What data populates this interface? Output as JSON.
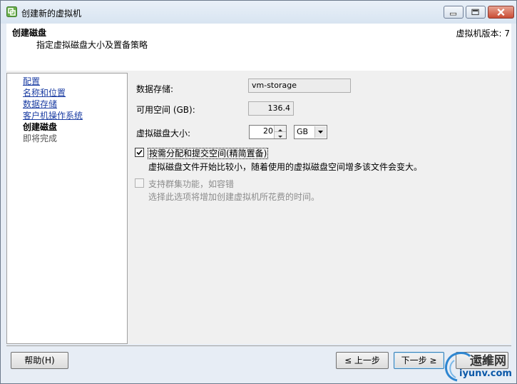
{
  "window": {
    "title": "创建新的虚拟机"
  },
  "header": {
    "title": "创建磁盘",
    "subtitle": "指定虚拟磁盘大小及置备策略",
    "version": "虚拟机版本: 7"
  },
  "nav": {
    "items": [
      {
        "label": "配置",
        "state": "link"
      },
      {
        "label": "名称和位置",
        "state": "link"
      },
      {
        "label": "数据存储",
        "state": "link"
      },
      {
        "label": "客户机操作系统",
        "state": "link"
      },
      {
        "label": "创建磁盘",
        "state": "current"
      },
      {
        "label": "即将完成",
        "state": "pending"
      }
    ]
  },
  "form": {
    "datastore_label": "数据存储:",
    "datastore_value": "vm-storage",
    "free_space_label": "可用空间 (GB):",
    "free_space_value": "136.4",
    "disk_size_label": "虚拟磁盘大小:",
    "disk_size_value": "20",
    "disk_size_unit": "GB",
    "thin_checkbox_label": "按需分配和提交空间(精简置备)",
    "thin_checkbox_checked": true,
    "thin_description": "虚拟磁盘文件开始比较小，随着使用的虚拟磁盘空间增多该文件会变大。",
    "cluster_checkbox_label": "支持群集功能，如容错",
    "cluster_checkbox_checked": false,
    "cluster_description": "选择此选项将增加创建虚拟机所花费的时间。"
  },
  "footer": {
    "help_label": "帮助(H)",
    "back_label": "≤ 上一步",
    "next_label": "下一步 ≥",
    "cancel_label": "取消"
  },
  "watermark": {
    "text1": "运维网",
    "text2": "iyunv.com"
  },
  "colors": {
    "link": "#1c3ea3",
    "frame": "#e7edf5",
    "panel": "#f0f0f0"
  }
}
